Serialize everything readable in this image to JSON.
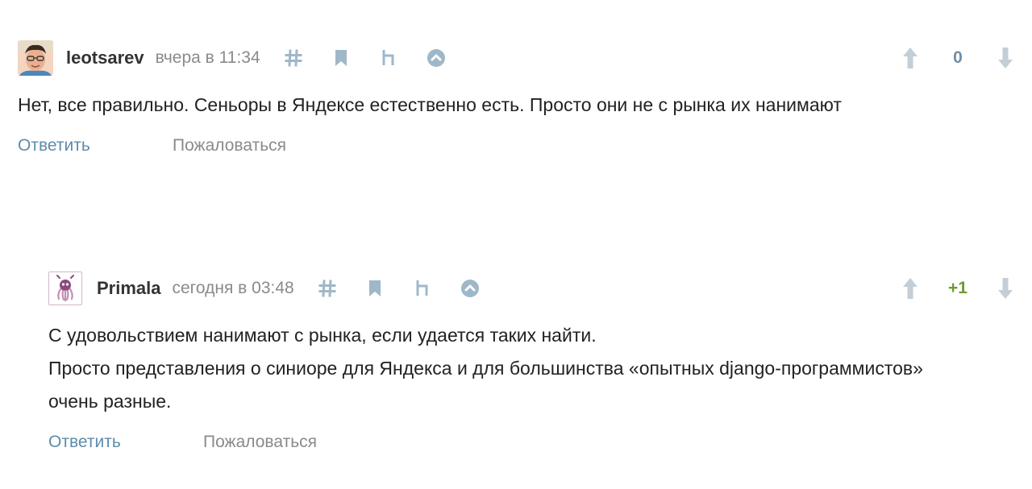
{
  "comments": [
    {
      "author": "leotsarev",
      "time": "вчера в 11:34",
      "score": "0",
      "text": [
        "Нет, все правильно. Сеньоры в Яндексе естественно есть. Просто они не с рынка их нанимают"
      ],
      "reply_label": "Ответить",
      "report_label": "Пожаловаться"
    },
    {
      "author": "Primala",
      "time": "сегодня в 03:48",
      "score": "+1",
      "text": [
        "С удовольствием нанимают с рынка, если удается таких найти.",
        "Просто представления о синиоре для Яндекса и для большинства «опытных django-программистов» очень разные."
      ],
      "reply_label": "Ответить",
      "report_label": "Пожаловаться"
    }
  ],
  "icons": {
    "comment_actions": [
      "hash-icon",
      "bookmark-icon",
      "parent-link-icon",
      "scroll-up-icon"
    ],
    "vote_up": "arrow-up-icon",
    "vote_down": "arrow-down-icon"
  },
  "colors": {
    "icon": "#9fb8c9",
    "vote_arrow": "#c3ced6",
    "link": "#5e8cab",
    "score_neutral": "#6f8fa8",
    "score_positive": "#6d9b2f",
    "muted_text": "#8a8a8a"
  }
}
